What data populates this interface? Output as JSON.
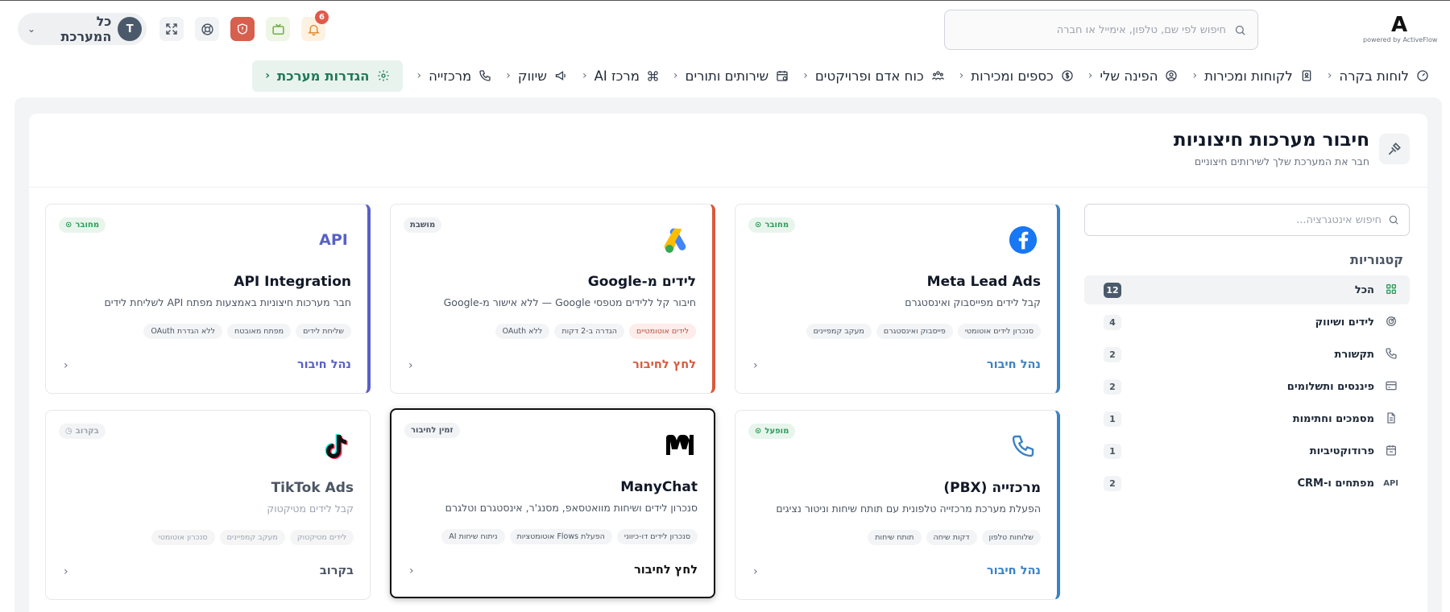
{
  "app": {
    "logo_letter": "A",
    "powered_by": "powered by ActiveFlow",
    "search_placeholder": "חיפוש לפי שם, טלפון, אימייל או חברה",
    "notification_count": "6",
    "avatar_initial": "T",
    "system_selector": "כל המערכת"
  },
  "nav": [
    {
      "label": "לוחות בקרה",
      "icon": "dashboard-icon"
    },
    {
      "label": "לקוחות ומכירות",
      "icon": "contacts-icon"
    },
    {
      "label": "הפינה שלי",
      "icon": "user-circle-icon"
    },
    {
      "label": "כספים ומכירות",
      "icon": "dollar-icon"
    },
    {
      "label": "כוח אדם ופרויקטים",
      "icon": "people-icon"
    },
    {
      "label": "שירותים ותורים",
      "icon": "calendar-icon"
    },
    {
      "label": "מרכז AI",
      "icon": "command-icon"
    },
    {
      "label": "שיווק",
      "icon": "megaphone-icon"
    },
    {
      "label": "מרכזייה",
      "icon": "phone-icon"
    },
    {
      "label": "הגדרות מערכת",
      "icon": "gear-icon",
      "active": true
    }
  ],
  "page": {
    "title": "חיבור מערכות חיצוניות",
    "subtitle": "חבר את המערכת שלך לשירותים חיצוניים"
  },
  "sidebar": {
    "search_placeholder": "חיפוש אינטגרציה...",
    "categories_title": "קטגוריות",
    "categories": [
      {
        "label": "הכל",
        "count": "12",
        "icon": "grid-icon",
        "active": true
      },
      {
        "label": "לידים ושיווק",
        "count": "4",
        "icon": "target-icon"
      },
      {
        "label": "תקשורת",
        "count": "2",
        "icon": "phone-icon"
      },
      {
        "label": "פיננסים ותשלומים",
        "count": "2",
        "icon": "credit-card-icon"
      },
      {
        "label": "מסמכים וחתימות",
        "count": "1",
        "icon": "document-icon"
      },
      {
        "label": "פרודוקטיביות",
        "count": "1",
        "icon": "calendar-icon"
      },
      {
        "label": "מפתחים ו-CRM",
        "count": "2",
        "icon_text": "API"
      }
    ]
  },
  "colors": {
    "accent_green": "#1f7a57",
    "link_blue": "#3b82c4",
    "google_red": "#d95a3c",
    "api_purple": "#5860c8",
    "status_green": "#2f9a5a"
  },
  "cards": [
    {
      "id": "meta",
      "title": "Meta Lead Ads",
      "desc": "קבל לידים מפייסבוק ואינסטגרם",
      "status": "מחובר",
      "tags": [
        "סנכרון לידים אוטומטי",
        "פייסבוק ואינסטגרם",
        "מעקב קמפיינים"
      ],
      "action": "נהל חיבור",
      "logo": "facebook-icon"
    },
    {
      "id": "google",
      "title": "לידים מ-Google",
      "desc": "חיבור קל ללידים מטפסי Google — ללא אישור מ-Google",
      "status": "מושבת",
      "tags": [
        "לידים אוטומטיים",
        "הגדרה ב-2 דקות",
        "ללא OAuth"
      ],
      "action": "לחץ לחיבור",
      "logo": "google-ads-icon"
    },
    {
      "id": "api",
      "title": "API Integration",
      "desc": "חבר מערכות חיצוניות באמצעות מפתח API לשליחת לידים",
      "status": "מחובר",
      "tags": [
        "שליחת לידים",
        "מפתח מאובטח",
        "ללא הגדרת OAuth"
      ],
      "action": "נהל חיבור",
      "logo_text": "API"
    },
    {
      "id": "pbx",
      "title": "מרכזייה (PBX)",
      "desc": "הפעלת מערכת מרכזייה טלפונית עם תותח שיחות וניטור נציגים",
      "status": "מופעל",
      "tags": [
        "שלוחות טלפון",
        "דקות שיחה",
        "תותח שיחות"
      ],
      "action": "נהל חיבור",
      "logo": "phone-icon"
    },
    {
      "id": "manychat",
      "title": "ManyChat",
      "desc": "סנכרון לידים ושיחות מוואטסאפ, מסנג'ר, אינסטגרם וטלגרם",
      "status": "זמין לחיבור",
      "tags": [
        "סנכרון לידים דו-כיווני",
        "הפעלת Flows אוטומטציות",
        "ניתוח שיחות AI"
      ],
      "action": "לחץ לחיבור",
      "logo": "manychat-icon"
    },
    {
      "id": "tiktok",
      "title": "TikTok Ads",
      "desc": "קבל לידים מטיקטוק",
      "status": "בקרוב",
      "tags": [
        "לידים מטיקטוק",
        "מעקב קמפיינים",
        "סנכרון אוטומטי"
      ],
      "action": "בקרוב",
      "logo": "tiktok-icon"
    }
  ]
}
